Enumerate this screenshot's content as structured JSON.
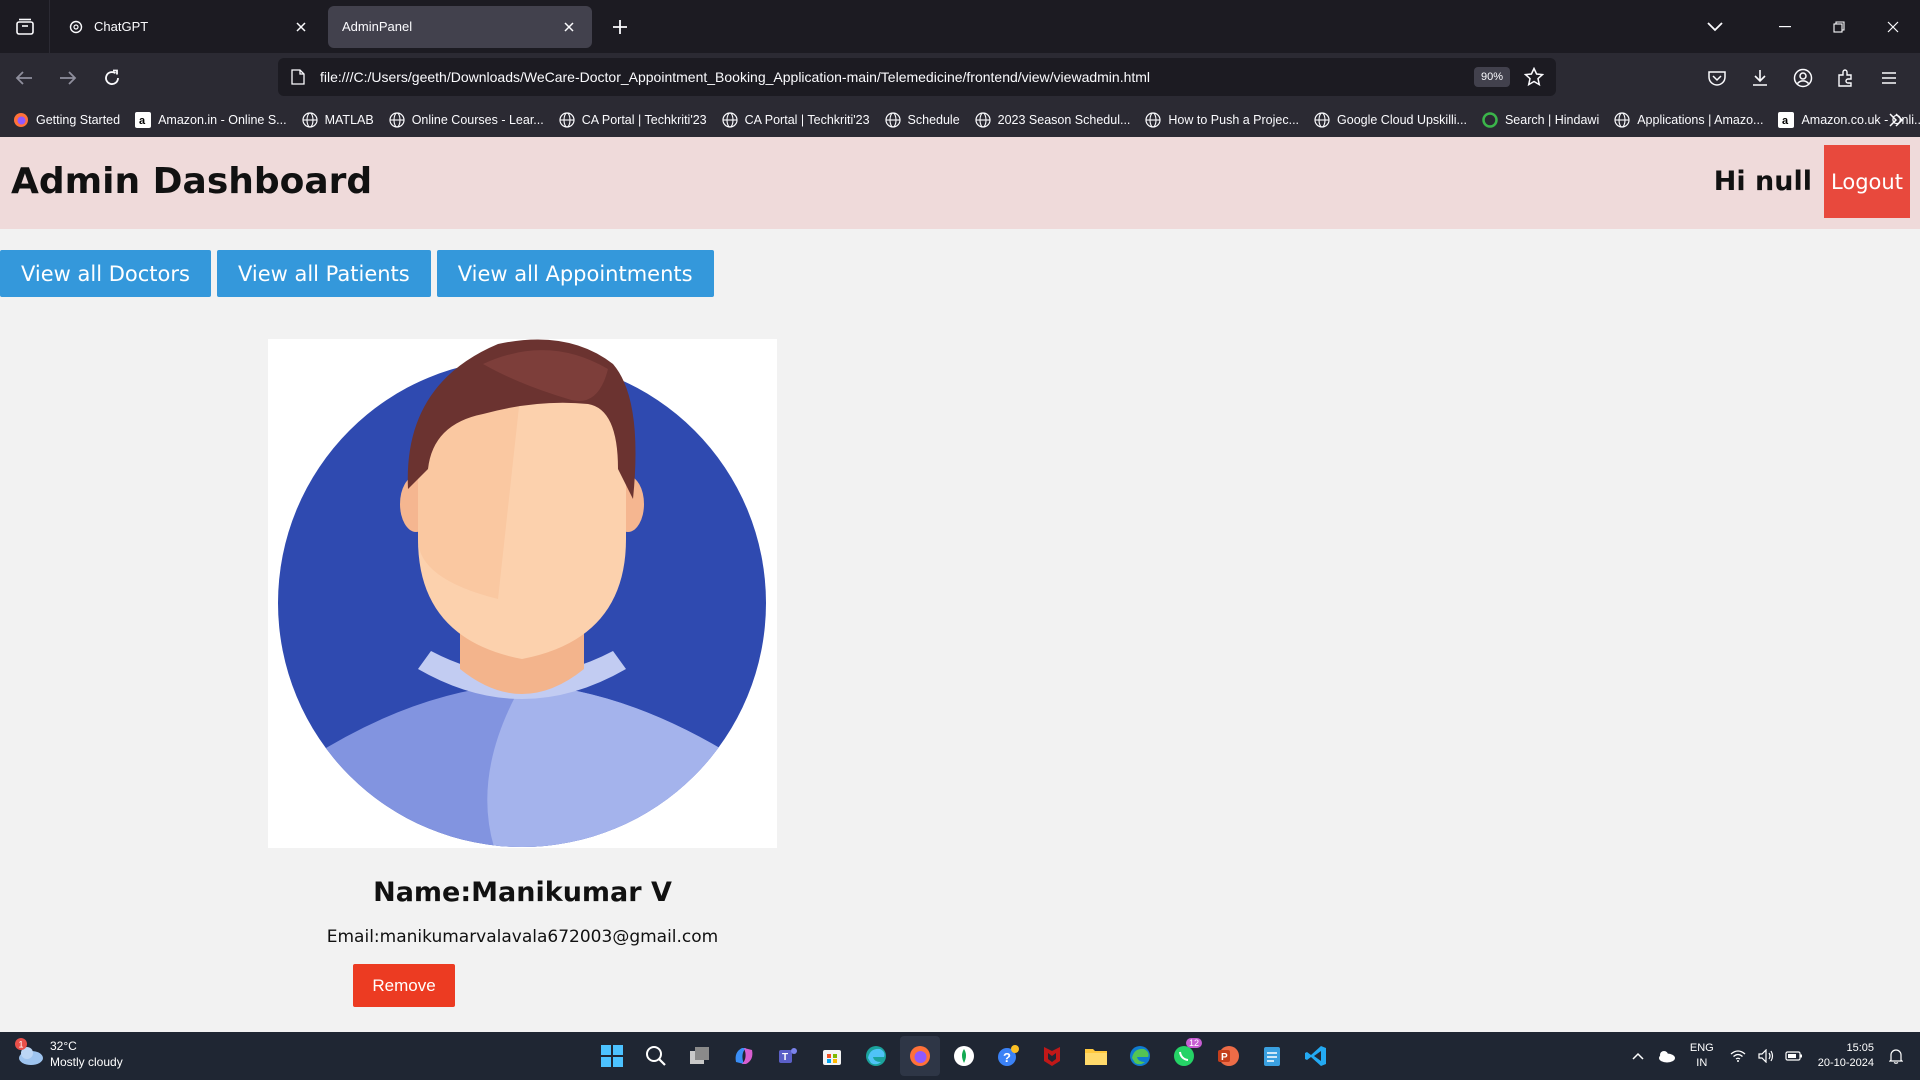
{
  "browser": {
    "tabs": [
      {
        "title": "ChatGPT",
        "active": false
      },
      {
        "title": "AdminPanel",
        "active": true
      }
    ],
    "url": "file:///C:/Users/geeth/Downloads/WeCare-Doctor_Appointment_Booking_Application-main/Telemedicine/frontend/view/viewadmin.html",
    "zoom": "90%",
    "bookmarks": [
      {
        "label": "Getting Started",
        "icon": "firefox-icon"
      },
      {
        "label": "Amazon.in - Online S...",
        "icon": "amazon-icon"
      },
      {
        "label": "MATLAB",
        "icon": "globe-icon"
      },
      {
        "label": "Online Courses - Lear...",
        "icon": "globe-icon"
      },
      {
        "label": "CA Portal | Techkriti'23",
        "icon": "globe-icon"
      },
      {
        "label": "CA Portal | Techkriti'23",
        "icon": "globe-icon"
      },
      {
        "label": "Schedule",
        "icon": "globe-icon"
      },
      {
        "label": "2023 Season Schedul...",
        "icon": "globe-icon"
      },
      {
        "label": "How to Push a Projec...",
        "icon": "globe-icon"
      },
      {
        "label": "Google Cloud Upskilli...",
        "icon": "globe-icon"
      },
      {
        "label": "Search | Hindawi",
        "icon": "hindawi-icon"
      },
      {
        "label": "Applications | Amazo...",
        "icon": "globe-icon"
      },
      {
        "label": "Amazon.co.uk - Onli...",
        "icon": "amazon-icon"
      }
    ]
  },
  "header": {
    "title": "Admin Dashboard",
    "greeting": "Hi null",
    "logout_label": "Logout"
  },
  "nav": {
    "doctors_label": "View all Doctors",
    "patients_label": "View all Patients",
    "appointments_label": "View all Appointments"
  },
  "admin_card": {
    "name": "Name:Manikumar V",
    "email": "Email:manikumarvalavala672003@gmail.com",
    "remove_label": "Remove"
  },
  "taskbar": {
    "weather_temp": "32°C",
    "weather_desc": "Mostly cloudy",
    "weather_badge": "1",
    "whatsapp_badge": "12",
    "lang_line1": "ENG",
    "lang_line2": "IN",
    "time": "15:05",
    "date": "20-10-2024"
  },
  "colors": {
    "header_bg": "#efdada",
    "nav_button": "#3498db",
    "logout_button": "#e8493d",
    "remove_button": "#ec3b22",
    "avatar_circle": "#2f4ab0"
  }
}
